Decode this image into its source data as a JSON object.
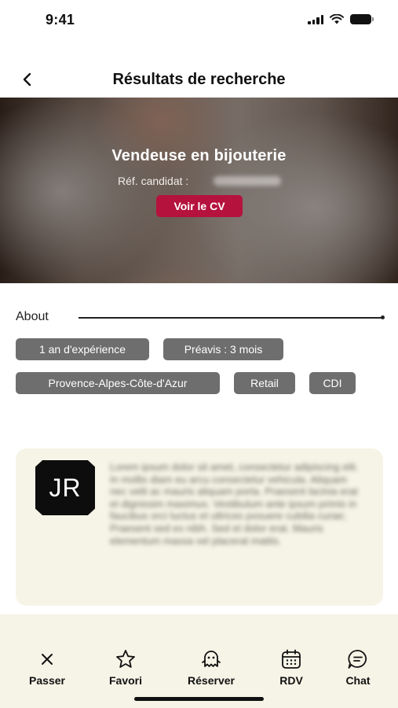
{
  "status_bar": {
    "time": "9:41"
  },
  "header": {
    "title": "Résultats de recherche"
  },
  "hero": {
    "title": "Vendeuse en bijouterie",
    "ref_label": "Réf. candidat :",
    "cv_button": "Voir le CV"
  },
  "about": {
    "label": "About",
    "tags": [
      "1 an d'expérience",
      "Préavis : 3 mois",
      "Provence-Alpes-Côte-d'Azur",
      "Retail",
      "CDI"
    ]
  },
  "profile": {
    "initials": "JR",
    "bio": "Lorem ipsum dolor sit amet, consectetur adipiscing elit. In mollis diam eu arcu consectetur vehicula. Aliquam nec velit ac mauris aliquam porta. Praesent lacinia erat et dignissim maximus. Vestibulum ante ipsum primis in faucibus orci luctus et ultrices posuere cubilia curae; Praesent sed ex nibh. Sed et dolor erat. Mauris elementum massa vel placerat mattis."
  },
  "nav": {
    "items": [
      {
        "label": "Passer",
        "icon": "close-icon"
      },
      {
        "label": "Favori",
        "icon": "star-icon"
      },
      {
        "label": "Réserver",
        "icon": "ghost-icon"
      },
      {
        "label": "RDV",
        "icon": "calendar-icon"
      },
      {
        "label": "Chat",
        "icon": "chat-icon"
      }
    ]
  },
  "colors": {
    "accent": "#b5123e",
    "tag": "#6e6e6e",
    "card": "#f6f4e7"
  }
}
